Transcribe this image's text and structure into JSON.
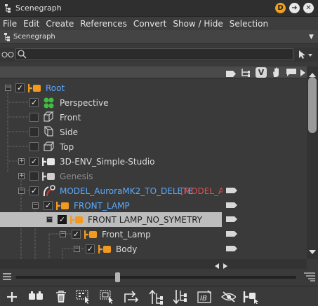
{
  "window": {
    "title": "Scenegraph"
  },
  "menu": [
    "File",
    "Edit",
    "Create",
    "References",
    "Convert",
    "Show / Hide",
    "Selection"
  ],
  "panel_tab": {
    "label": "Scenegraph"
  },
  "tree": [
    {
      "label": "Root",
      "checked": true,
      "color": "#5aa9ff",
      "icon": "group-orange-icon"
    },
    {
      "label": "Perspective",
      "checked": true,
      "color": "#e6e6e6",
      "icon": "camera-green-icon"
    },
    {
      "label": "Front",
      "checked": false,
      "color": "#e6e6e6",
      "icon": "cube-icon"
    },
    {
      "label": "Side",
      "checked": false,
      "color": "#e6e6e6",
      "icon": "cube-icon"
    },
    {
      "label": "Top",
      "checked": false,
      "color": "#e6e6e6",
      "icon": "cube-icon"
    },
    {
      "label": "3D-ENV_Simple-Studio",
      "checked": true,
      "color": "#e6e6e6",
      "icon": "group-white-icon"
    },
    {
      "label": "Genesis",
      "checked": false,
      "color": "#8c8c8c",
      "icon": "group-white-icon"
    },
    {
      "label": "MODEL_AuroraMK2_TO_DELETE",
      "suffix": "[MODEL_A",
      "checked": true,
      "color": "#5aa9ff",
      "suffix_color": "#e05050",
      "icon": "reference-icon"
    },
    {
      "label": "FRONT_LAMP",
      "checked": true,
      "color": "#5aa9ff",
      "icon": "group-orange-icon"
    },
    {
      "label": "FRONT LAMP_NO_SYMETRY",
      "checked": true,
      "color": "#1c1c1c",
      "icon": "group-orange-icon",
      "selected": true
    },
    {
      "label": "Front_Lamp",
      "checked": true,
      "color": "#e6e6e6",
      "icon": "group-orange-icon"
    },
    {
      "label": "Body",
      "checked": true,
      "color": "#e6e6e6",
      "icon": "group-orange-icon"
    }
  ],
  "header_icons": [
    "tag-icon",
    "hierarchy-icon",
    "v-icon",
    "hand-icon",
    "comment-icon",
    "arrow-right-icon"
  ],
  "toolbar_icons": [
    "add-icon",
    "duplicate-icon",
    "delete-icon",
    "select-all-icon",
    "select-children-icon",
    "move-icon",
    "move-up-icon",
    "move-down-icon",
    "rename-icon",
    "hide-icon",
    "tag-tool-icon"
  ]
}
